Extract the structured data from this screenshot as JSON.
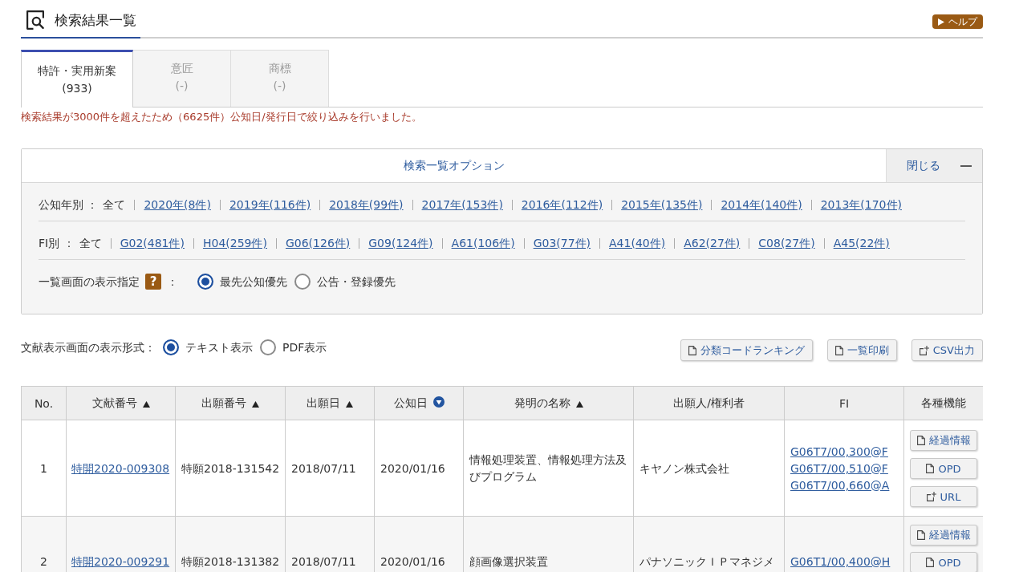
{
  "header": {
    "title": "検索結果一覧",
    "help_button": "ヘルプ"
  },
  "tabs": [
    {
      "label": "特許・実用新案",
      "count": "(933)",
      "selected": true
    },
    {
      "label": "意匠",
      "count": "(-)",
      "selected": false
    },
    {
      "label": "商標",
      "count": "(-)",
      "selected": false
    }
  ],
  "notice": "検索結果が3000件を超えたため（6625件）公知日/発行日で絞り込みを行いました。",
  "options_panel": {
    "title": "検索一覧オプション",
    "close_button": "閉じる",
    "expanded": true,
    "filters": [
      {
        "label": "公知年別 ：",
        "current": "全て",
        "links": [
          "2020年(8件)",
          "2019年(116件)",
          "2018年(99件)",
          "2017年(153件)",
          "2016年(112件)",
          "2015年(135件)",
          "2014年(140件)",
          "2013年(170件)"
        ]
      },
      {
        "label": "FI別 ：",
        "current": "全て",
        "links": [
          "G02(481件)",
          "H04(259件)",
          "G06(126件)",
          "G09(124件)",
          "A61(106件)",
          "G03(77件)",
          "A41(40件)",
          "A62(27件)",
          "C08(27件)",
          "A45(22件)"
        ]
      }
    ],
    "display_setting": {
      "label": "一覧画面の表示指定",
      "help_mark": "?",
      "colon": "：",
      "options": [
        {
          "label": "最先公知優先",
          "selected": true
        },
        {
          "label": "公告・登録優先",
          "selected": false
        }
      ]
    }
  },
  "display_format": {
    "label": "文献表示画面の表示形式：",
    "options": [
      {
        "label": "テキスト表示",
        "selected": true
      },
      {
        "label": "PDF表示",
        "selected": false
      }
    ],
    "buttons": [
      {
        "label": "分類コードランキング",
        "kind": "document"
      },
      {
        "label": "一覧印刷",
        "kind": "document"
      },
      {
        "label": "CSV出力",
        "kind": "export"
      }
    ]
  },
  "table": {
    "columns": [
      {
        "label": "No.",
        "kind": "plain"
      },
      {
        "label": "文献番号",
        "kind": "sortable"
      },
      {
        "label": "出願番号",
        "kind": "sortable"
      },
      {
        "label": "出願日",
        "kind": "sortable"
      },
      {
        "label": "公知日",
        "kind": "sorted"
      },
      {
        "label": "発明の名称",
        "kind": "sortable"
      },
      {
        "label": "出願人/権利者",
        "kind": "plain"
      },
      {
        "label": "FI",
        "kind": "plain"
      },
      {
        "label": "各種機能",
        "kind": "plain"
      }
    ],
    "rows": [
      {
        "no": "1",
        "document_number": "特開2020-009308",
        "application_number": "特願2018-131542",
        "filing_date": "2018/07/11",
        "publication_date": "2020/01/16",
        "title": "情報処理装置、情報処理方法及びプログラム",
        "applicant": "キヤノン株式会社",
        "fi": [
          "G06T7/00,300@F",
          "G06T7/00,510@F",
          "G06T7/00,660@A"
        ],
        "actions": [
          {
            "label": "経過情報",
            "kind": "document"
          },
          {
            "label": "OPD",
            "kind": "document"
          },
          {
            "label": "URL",
            "kind": "export"
          }
        ]
      },
      {
        "no": "2",
        "document_number": "特開2020-009291",
        "application_number": "特願2018-131382",
        "filing_date": "2018/07/11",
        "publication_date": "2020/01/16",
        "title": "顔画像選択装置",
        "applicant": "パナソニックＩＰマネジメ",
        "fi": [
          "G06T1/00,400@H"
        ],
        "actions": [
          {
            "label": "経過情報",
            "kind": "document"
          },
          {
            "label": "OPD",
            "kind": "document"
          }
        ]
      }
    ]
  }
}
